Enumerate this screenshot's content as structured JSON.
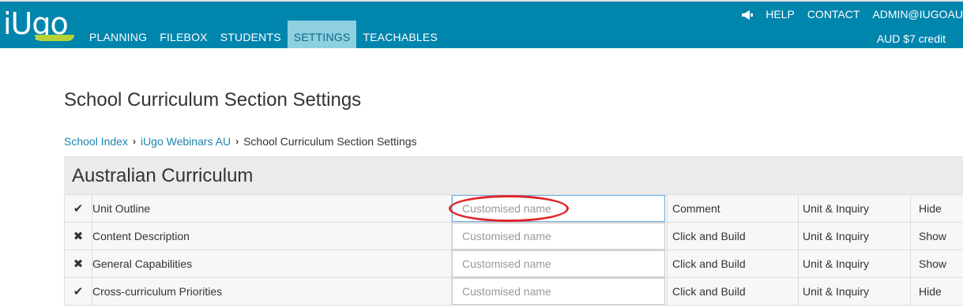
{
  "app": {
    "logo": "iUgo"
  },
  "nav": {
    "items": [
      {
        "label": "PLANNING",
        "active": false
      },
      {
        "label": "FILEBOX",
        "active": false
      },
      {
        "label": "STUDENTS",
        "active": false
      },
      {
        "label": "SETTINGS",
        "active": true
      },
      {
        "label": "TEACHABLES",
        "active": false
      }
    ]
  },
  "topright": {
    "icon": "megaphone-icon",
    "help": "HELP",
    "contact": "CONTACT",
    "user": "ADMIN@IUGOAU",
    "credit": "AUD $7 credit"
  },
  "page": {
    "title": "School Curriculum Section Settings",
    "breadcrumb": [
      "School Index",
      "iUgo Webinars AU",
      "School Curriculum Section Settings"
    ]
  },
  "section": {
    "title": "Australian Curriculum",
    "rows": [
      {
        "mark": "✔",
        "name": "Unit Outline",
        "placeholder": "Customised name",
        "type": "Comment",
        "scope": "Unit & Inquiry",
        "visibility": "Hide"
      },
      {
        "mark": "✖",
        "name": "Content Description",
        "placeholder": "Customised name",
        "type": "Click and Build",
        "scope": "Unit & Inquiry",
        "visibility": "Show"
      },
      {
        "mark": "✖",
        "name": "General Capabilities",
        "placeholder": "Customised name",
        "type": "Click and Build",
        "scope": "Unit & Inquiry",
        "visibility": "Show"
      },
      {
        "mark": "✔",
        "name": "Cross-curriculum Priorities",
        "placeholder": "Customised name",
        "type": "Click and Build",
        "scope": "Unit & Inquiry",
        "visibility": "Hide"
      }
    ]
  },
  "colors": {
    "header": "#0085ad",
    "active_tab": "#8ecfe0",
    "highlight": "#e0262d",
    "link": "#1a86b0"
  }
}
